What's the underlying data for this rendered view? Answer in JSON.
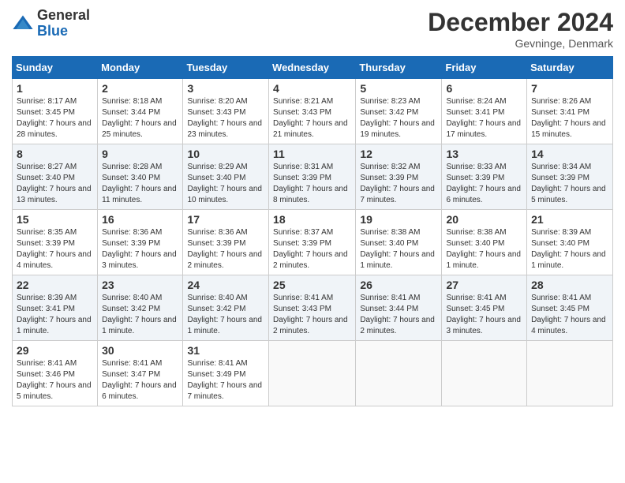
{
  "header": {
    "logo_general": "General",
    "logo_blue": "Blue",
    "month_title": "December 2024",
    "location": "Gevninge, Denmark"
  },
  "weekdays": [
    "Sunday",
    "Monday",
    "Tuesday",
    "Wednesday",
    "Thursday",
    "Friday",
    "Saturday"
  ],
  "rows": [
    [
      {
        "day": "1",
        "sunrise": "Sunrise: 8:17 AM",
        "sunset": "Sunset: 3:45 PM",
        "daylight": "Daylight: 7 hours and 28 minutes."
      },
      {
        "day": "2",
        "sunrise": "Sunrise: 8:18 AM",
        "sunset": "Sunset: 3:44 PM",
        "daylight": "Daylight: 7 hours and 25 minutes."
      },
      {
        "day": "3",
        "sunrise": "Sunrise: 8:20 AM",
        "sunset": "Sunset: 3:43 PM",
        "daylight": "Daylight: 7 hours and 23 minutes."
      },
      {
        "day": "4",
        "sunrise": "Sunrise: 8:21 AM",
        "sunset": "Sunset: 3:43 PM",
        "daylight": "Daylight: 7 hours and 21 minutes."
      },
      {
        "day": "5",
        "sunrise": "Sunrise: 8:23 AM",
        "sunset": "Sunset: 3:42 PM",
        "daylight": "Daylight: 7 hours and 19 minutes."
      },
      {
        "day": "6",
        "sunrise": "Sunrise: 8:24 AM",
        "sunset": "Sunset: 3:41 PM",
        "daylight": "Daylight: 7 hours and 17 minutes."
      },
      {
        "day": "7",
        "sunrise": "Sunrise: 8:26 AM",
        "sunset": "Sunset: 3:41 PM",
        "daylight": "Daylight: 7 hours and 15 minutes."
      }
    ],
    [
      {
        "day": "8",
        "sunrise": "Sunrise: 8:27 AM",
        "sunset": "Sunset: 3:40 PM",
        "daylight": "Daylight: 7 hours and 13 minutes."
      },
      {
        "day": "9",
        "sunrise": "Sunrise: 8:28 AM",
        "sunset": "Sunset: 3:40 PM",
        "daylight": "Daylight: 7 hours and 11 minutes."
      },
      {
        "day": "10",
        "sunrise": "Sunrise: 8:29 AM",
        "sunset": "Sunset: 3:40 PM",
        "daylight": "Daylight: 7 hours and 10 minutes."
      },
      {
        "day": "11",
        "sunrise": "Sunrise: 8:31 AM",
        "sunset": "Sunset: 3:39 PM",
        "daylight": "Daylight: 7 hours and 8 minutes."
      },
      {
        "day": "12",
        "sunrise": "Sunrise: 8:32 AM",
        "sunset": "Sunset: 3:39 PM",
        "daylight": "Daylight: 7 hours and 7 minutes."
      },
      {
        "day": "13",
        "sunrise": "Sunrise: 8:33 AM",
        "sunset": "Sunset: 3:39 PM",
        "daylight": "Daylight: 7 hours and 6 minutes."
      },
      {
        "day": "14",
        "sunrise": "Sunrise: 8:34 AM",
        "sunset": "Sunset: 3:39 PM",
        "daylight": "Daylight: 7 hours and 5 minutes."
      }
    ],
    [
      {
        "day": "15",
        "sunrise": "Sunrise: 8:35 AM",
        "sunset": "Sunset: 3:39 PM",
        "daylight": "Daylight: 7 hours and 4 minutes."
      },
      {
        "day": "16",
        "sunrise": "Sunrise: 8:36 AM",
        "sunset": "Sunset: 3:39 PM",
        "daylight": "Daylight: 7 hours and 3 minutes."
      },
      {
        "day": "17",
        "sunrise": "Sunrise: 8:36 AM",
        "sunset": "Sunset: 3:39 PM",
        "daylight": "Daylight: 7 hours and 2 minutes."
      },
      {
        "day": "18",
        "sunrise": "Sunrise: 8:37 AM",
        "sunset": "Sunset: 3:39 PM",
        "daylight": "Daylight: 7 hours and 2 minutes."
      },
      {
        "day": "19",
        "sunrise": "Sunrise: 8:38 AM",
        "sunset": "Sunset: 3:40 PM",
        "daylight": "Daylight: 7 hours and 1 minute."
      },
      {
        "day": "20",
        "sunrise": "Sunrise: 8:38 AM",
        "sunset": "Sunset: 3:40 PM",
        "daylight": "Daylight: 7 hours and 1 minute."
      },
      {
        "day": "21",
        "sunrise": "Sunrise: 8:39 AM",
        "sunset": "Sunset: 3:40 PM",
        "daylight": "Daylight: 7 hours and 1 minute."
      }
    ],
    [
      {
        "day": "22",
        "sunrise": "Sunrise: 8:39 AM",
        "sunset": "Sunset: 3:41 PM",
        "daylight": "Daylight: 7 hours and 1 minute."
      },
      {
        "day": "23",
        "sunrise": "Sunrise: 8:40 AM",
        "sunset": "Sunset: 3:42 PM",
        "daylight": "Daylight: 7 hours and 1 minute."
      },
      {
        "day": "24",
        "sunrise": "Sunrise: 8:40 AM",
        "sunset": "Sunset: 3:42 PM",
        "daylight": "Daylight: 7 hours and 1 minute."
      },
      {
        "day": "25",
        "sunrise": "Sunrise: 8:41 AM",
        "sunset": "Sunset: 3:43 PM",
        "daylight": "Daylight: 7 hours and 2 minutes."
      },
      {
        "day": "26",
        "sunrise": "Sunrise: 8:41 AM",
        "sunset": "Sunset: 3:44 PM",
        "daylight": "Daylight: 7 hours and 2 minutes."
      },
      {
        "day": "27",
        "sunrise": "Sunrise: 8:41 AM",
        "sunset": "Sunset: 3:45 PM",
        "daylight": "Daylight: 7 hours and 3 minutes."
      },
      {
        "day": "28",
        "sunrise": "Sunrise: 8:41 AM",
        "sunset": "Sunset: 3:45 PM",
        "daylight": "Daylight: 7 hours and 4 minutes."
      }
    ],
    [
      {
        "day": "29",
        "sunrise": "Sunrise: 8:41 AM",
        "sunset": "Sunset: 3:46 PM",
        "daylight": "Daylight: 7 hours and 5 minutes."
      },
      {
        "day": "30",
        "sunrise": "Sunrise: 8:41 AM",
        "sunset": "Sunset: 3:47 PM",
        "daylight": "Daylight: 7 hours and 6 minutes."
      },
      {
        "day": "31",
        "sunrise": "Sunrise: 8:41 AM",
        "sunset": "Sunset: 3:49 PM",
        "daylight": "Daylight: 7 hours and 7 minutes."
      },
      null,
      null,
      null,
      null
    ]
  ]
}
